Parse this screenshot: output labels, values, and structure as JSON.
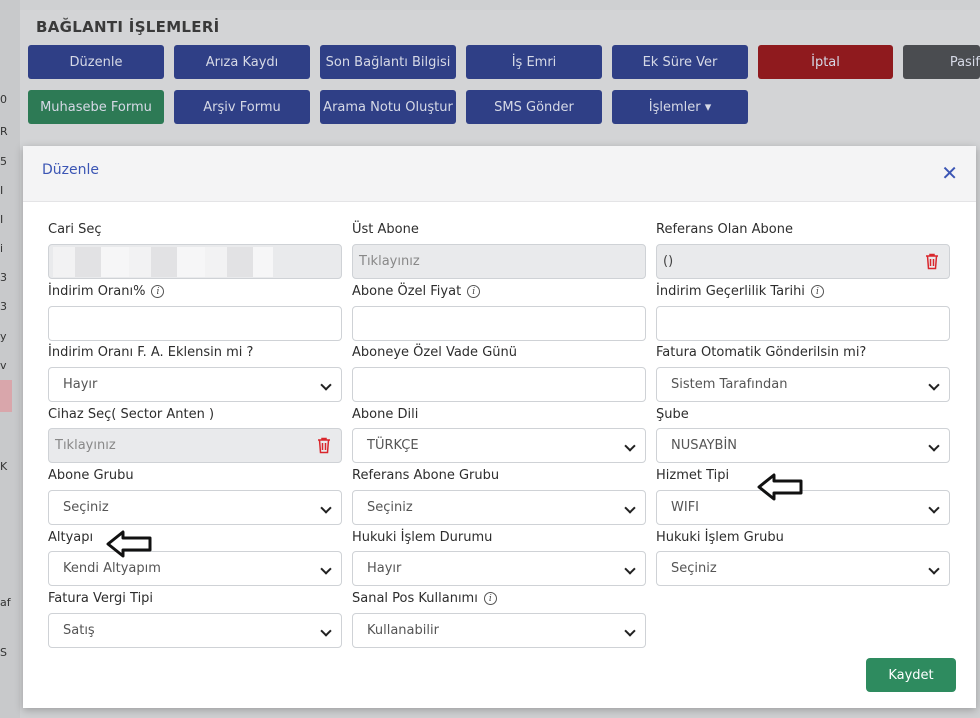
{
  "background": {
    "title": "BAĞLANTI İŞLEMLERİ",
    "buttons_row1": [
      "Düzenle",
      "Arıza Kaydı",
      "Son Bağlantı Bilgisi",
      "İş Emri",
      "Ek Süre Ver",
      "İptal",
      "Pasif"
    ],
    "buttons_row2": [
      "Muhasebe Formu",
      "Arşiv Formu",
      "Arama Notu Oluştur",
      "SMS Gönder",
      "İşlemler ▾"
    ],
    "left_fragments": [
      "0",
      "R",
      "5",
      "I",
      "I",
      "i",
      "3",
      "3",
      "y",
      "v",
      "K",
      "af",
      "S"
    ]
  },
  "modal": {
    "title": "Düzenle",
    "close_glyph": "✕",
    "save_label": "Kaydet",
    "fields": {
      "cari_sec": {
        "label": "Cari Seç",
        "value": ""
      },
      "ust_abone": {
        "label": "Üst Abone",
        "value": "Tıklayınız"
      },
      "referans_olan_abone": {
        "label": "Referans Olan Abone",
        "value": "()"
      },
      "indirim_orani": {
        "label": "İndirim Oranı%",
        "value": ""
      },
      "abone_ozel_fiyat": {
        "label": "Abone Özel Fiyat",
        "value": ""
      },
      "indirim_gecerlilik": {
        "label": "İndirim Geçerlilik Tarihi",
        "value": ""
      },
      "indirim_fa": {
        "label": "İndirim Oranı F. A. Eklensin mi ?",
        "value": "Hayır"
      },
      "ozel_vade": {
        "label": "Aboneye Özel Vade Günü",
        "value": ""
      },
      "fatura_otomatik": {
        "label": "Fatura Otomatik Gönderilsin mi?",
        "value": "Sistem Tarafından"
      },
      "cihaz_sec": {
        "label": "Cihaz Seç( Sector Anten )",
        "value": "Tıklayınız"
      },
      "abone_dili": {
        "label": "Abone Dili",
        "value": "TÜRKÇE"
      },
      "sube": {
        "label": "Şube",
        "value": "NUSAYBİN"
      },
      "abone_grubu": {
        "label": "Abone Grubu",
        "value": "Seçiniz"
      },
      "referans_abone_grubu": {
        "label": "Referans Abone Grubu",
        "value": "Seçiniz"
      },
      "hizmet_tipi": {
        "label": "Hizmet Tipi",
        "value": "WIFI"
      },
      "altyapi": {
        "label": "Altyapı",
        "value": "Kendi Altyapım"
      },
      "hukuki_islem_durumu": {
        "label": "Hukuki İşlem Durumu",
        "value": "Hayır"
      },
      "hukuki_islem_grubu": {
        "label": "Hukuki İşlem Grubu",
        "value": "Seçiniz"
      },
      "fatura_vergi_tipi": {
        "label": "Fatura Vergi Tipi",
        "value": "Satış"
      },
      "sanal_pos": {
        "label": "Sanal Pos Kullanımı",
        "value": "Kullanabilir"
      }
    }
  },
  "colors": {
    "accent": "#3b55b4",
    "save": "#2e8b5f",
    "danger": "#d9262c"
  }
}
